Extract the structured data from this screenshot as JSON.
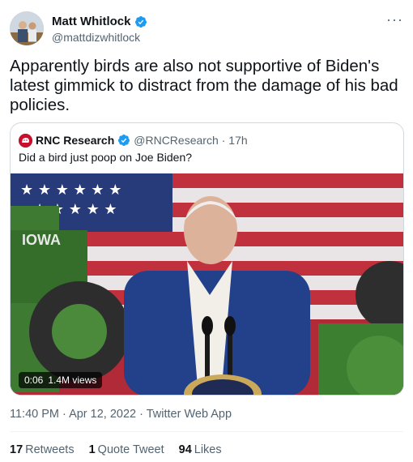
{
  "author": {
    "name": "Matt Whitlock",
    "handle": "@mattdizwhitlock"
  },
  "tweet": {
    "text": "Apparently birds are also not supportive of Biden's latest gimmick to distract from the damage of his bad policies."
  },
  "quoted": {
    "name": "RNC Research",
    "handle": "@RNCResearch",
    "time": "· 17h",
    "text": "Did a bird just poop on Joe Biden?",
    "video": {
      "duration": "0:06",
      "views": "1.4M views",
      "tractor_text": "IOWA"
    }
  },
  "meta": {
    "timestamp": "11:40 PM · Apr 12, 2022 · Twitter Web App"
  },
  "stats": {
    "retweets_count": "17",
    "retweets_label": "Retweets",
    "quote_count": "1",
    "quote_label": "Quote Tweet",
    "likes_count": "94",
    "likes_label": "Likes"
  },
  "colors": {
    "verified": "#1d9bf0",
    "rnc_red": "#c8102e",
    "muted_text": "#536471",
    "border": "#cfd9de"
  },
  "icons": {
    "verified": "verified-badge-icon",
    "more": "more-horizontal-icon"
  }
}
